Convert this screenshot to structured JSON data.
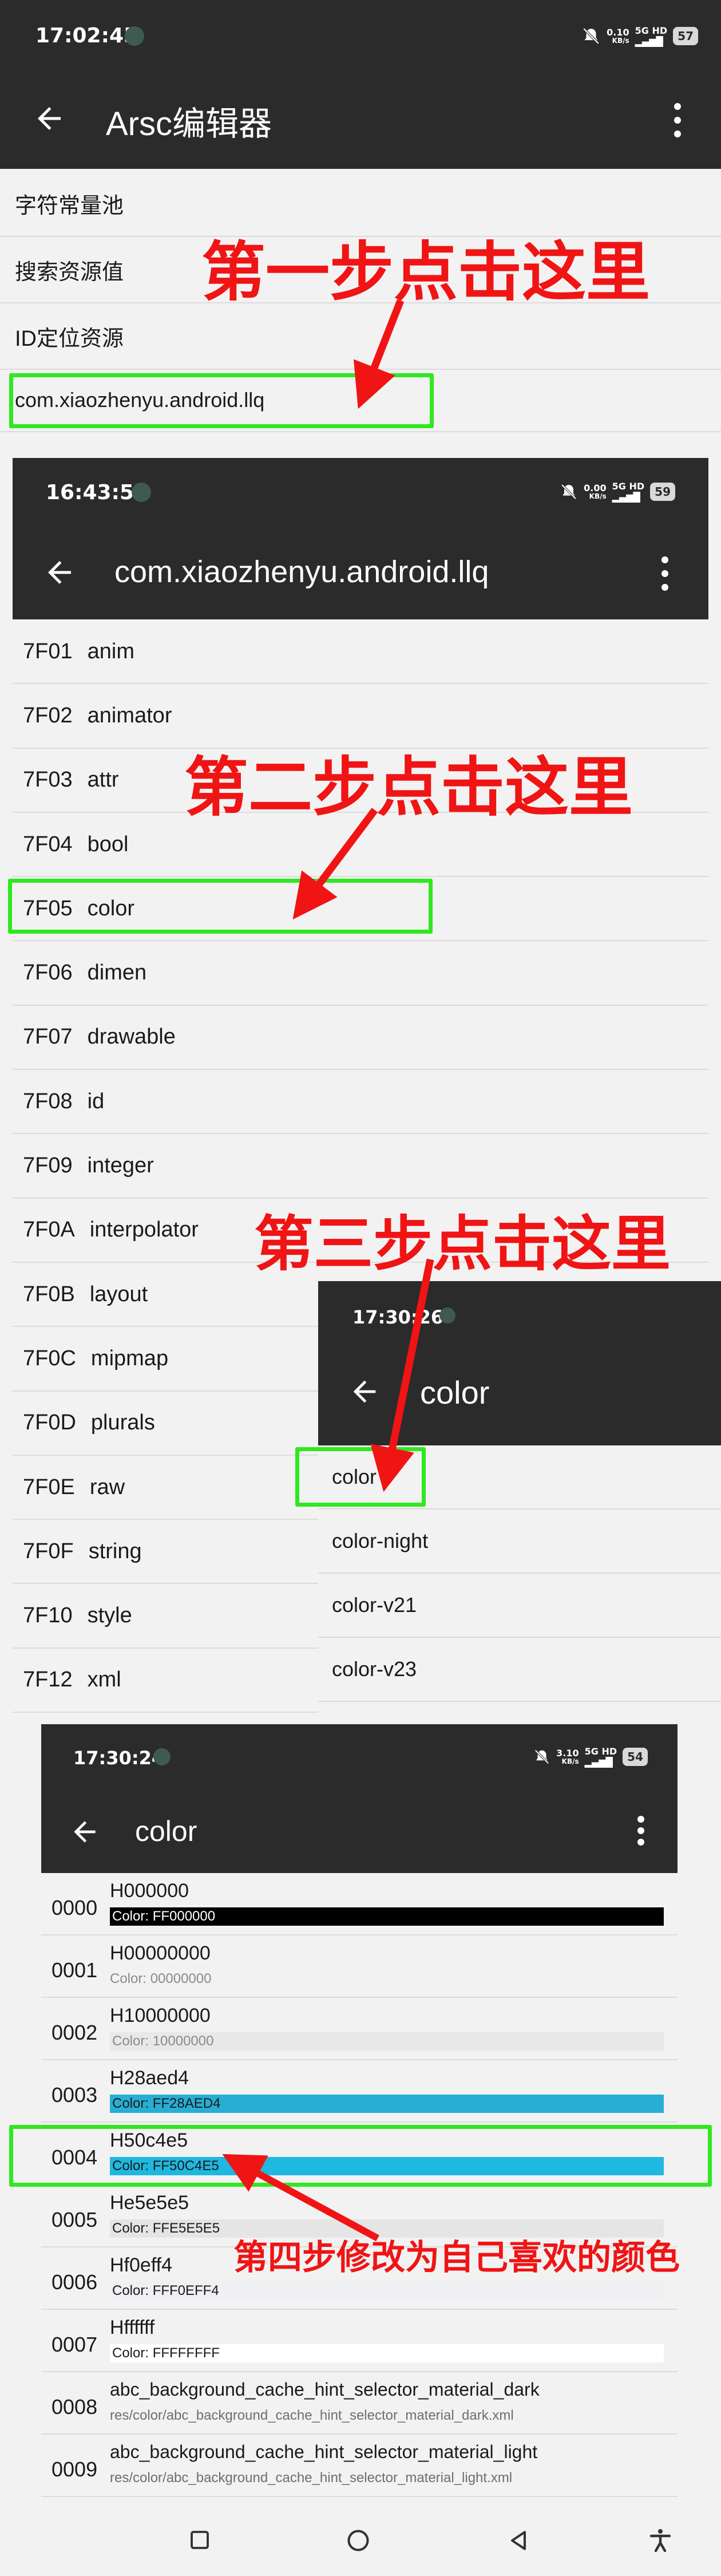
{
  "screen1": {
    "time": "17:02:45",
    "net_speed": "0.10",
    "net_unit": "KB/s",
    "signal": "5G HD",
    "battery": "57",
    "title": "Arsc编辑器",
    "items": [
      {
        "label": "字符常量池"
      },
      {
        "label": "搜索资源值"
      },
      {
        "label": "ID定位资源"
      },
      {
        "label": "com.xiaozhenyu.android.llq"
      }
    ]
  },
  "screen2": {
    "time": "16:43:50",
    "net_speed": "0.00",
    "net_unit": "KB/s",
    "signal": "5G HD",
    "battery": "59",
    "title": "com.xiaozhenyu.android.llq",
    "items": [
      {
        "code": "7F01",
        "name": "anim"
      },
      {
        "code": "7F02",
        "name": "animator"
      },
      {
        "code": "7F03",
        "name": "attr"
      },
      {
        "code": "7F04",
        "name": "bool"
      },
      {
        "code": "7F05",
        "name": "color"
      },
      {
        "code": "7F06",
        "name": "dimen"
      },
      {
        "code": "7F07",
        "name": "drawable"
      },
      {
        "code": "7F08",
        "name": "id"
      },
      {
        "code": "7F09",
        "name": "integer"
      },
      {
        "code": "7F0A",
        "name": "interpolator"
      },
      {
        "code": "7F0B",
        "name": "layout"
      },
      {
        "code": "7F0C",
        "name": "mipmap"
      },
      {
        "code": "7F0D",
        "name": "plurals"
      },
      {
        "code": "7F0E",
        "name": "raw"
      },
      {
        "code": "7F0F",
        "name": "string"
      },
      {
        "code": "7F10",
        "name": "style"
      },
      {
        "code": "7F12",
        "name": "xml"
      }
    ]
  },
  "screen3": {
    "time": "17:30:26",
    "title": "color",
    "items": [
      {
        "label": "color"
      },
      {
        "label": "color-night"
      },
      {
        "label": "color-v21"
      },
      {
        "label": "color-v23"
      }
    ]
  },
  "screen4": {
    "time": "17:30:24",
    "net_speed": "3.10",
    "net_unit": "KB/s",
    "signal": "5G HD",
    "battery": "54",
    "title": "color",
    "rows": [
      {
        "idx": "0000",
        "name": "H000000",
        "sub": "Color: FF000000",
        "swatch": "#000000",
        "text_color": "#ffffff"
      },
      {
        "idx": "0001",
        "name": "H00000000",
        "sub": "Color: 00000000",
        "swatch": "",
        "text_color": "#8a8a8a"
      },
      {
        "idx": "0002",
        "name": "H10000000",
        "sub": "Color: 10000000",
        "swatch": "#e8e8e8",
        "text_color": "#8a8a8a"
      },
      {
        "idx": "0003",
        "name": "H28aed4",
        "sub": "Color: FF28AED4",
        "swatch": "#28aed4",
        "text_color": "#1a1a1a"
      },
      {
        "idx": "0004",
        "name": "H50c4e5",
        "sub": "Color: FF50C4E5",
        "swatch": "#1fb8e0",
        "text_color": "#1a1a1a"
      },
      {
        "idx": "0005",
        "name": "He5e5e5",
        "sub": "Color: FFE5E5E5",
        "swatch": "#e5e5e5",
        "text_color": "#1a1a1a"
      },
      {
        "idx": "0006",
        "name": "Hf0eff4",
        "sub": "Color: FFF0EFF4",
        "swatch": "#f0eff4",
        "text_color": "#1a1a1a"
      },
      {
        "idx": "0007",
        "name": "Hffffff",
        "sub": "Color: FFFFFFFF",
        "swatch": "#ffffff",
        "text_color": "#1a1a1a"
      },
      {
        "idx": "0008",
        "name": "abc_background_cache_hint_selector_material_dark",
        "sub": "res/color/abc_background_cache_hint_selector_material_dark.xml",
        "swatch": "",
        "text_color": "#6e6e6e"
      },
      {
        "idx": "0009",
        "name": "abc_background_cache_hint_selector_material_light",
        "sub": "res/color/abc_background_cache_hint_selector_material_light.xml",
        "swatch": "",
        "text_color": "#6e6e6e"
      }
    ]
  },
  "annotations": {
    "step1": "第一步点击这里",
    "step2": "第二步点击这里",
    "step3": "第三步点击这里",
    "step4": "第四步修改为自己喜欢的颜色"
  },
  "colors": {
    "annotation": "#f01414",
    "highlight": "#2fe81f",
    "appbar": "#2b2b2b"
  },
  "icons": [
    "back-arrow-icon",
    "more-vert-icon",
    "mute-icon",
    "signal-icon",
    "battery-icon",
    "square-nav-icon",
    "circle-nav-icon",
    "triangle-nav-icon",
    "accessibility-icon"
  ]
}
